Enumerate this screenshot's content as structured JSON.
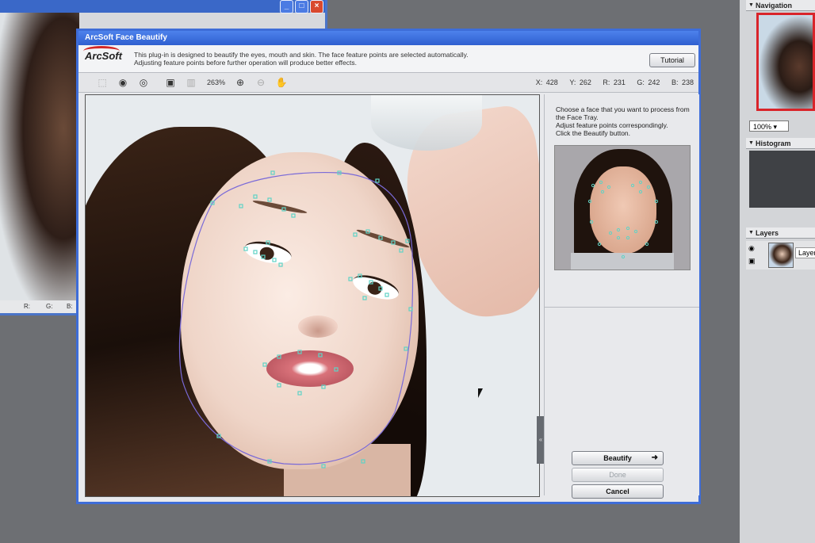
{
  "background_window": {
    "controls": [
      "_",
      "□",
      "×"
    ],
    "status": {
      "r": "R:",
      "g": "G:",
      "b": "B:"
    }
  },
  "right_panels": {
    "navigation": "Navigation",
    "zoom": "100%",
    "histogram": "Histogram",
    "layers": "Layers",
    "layer_name": "Layer-"
  },
  "dialog": {
    "title": "ArcSoft Face Beautify",
    "logo": "ArcSoft",
    "description_line1": "This plug-in is designed to beautify the eyes, mouth and skin. The face feature points are selected automatically.",
    "description_line2": "Adjusting feature points before further operation will produce better effects.",
    "tutorial_label": "Tutorial",
    "toolbar": {
      "zoom_percent": "263%"
    },
    "readout": {
      "x": "X: 428",
      "y": "Y: 262",
      "r": "R: 231",
      "g": "G: 242",
      "b": "B: 238"
    },
    "instructions": [
      "Choose a face that you want to process from",
      "the Face Tray.",
      "Adjust feature points correspondingly.",
      "Click the Beautify button."
    ],
    "buttons": {
      "beautify": "Beautify",
      "done": "Done",
      "cancel": "Cancel"
    }
  },
  "colors": {
    "titlebar": "#3e6dd8",
    "feature_point": "#5fd3c6",
    "face_outline": "#7a6ad8"
  },
  "icons": {
    "tool1": "face-select-icon",
    "tool2": "eye-icon",
    "tool3": "mouth-icon",
    "tool4": "fit-screen-icon",
    "tool5": "actual-size-icon",
    "zoom_in": "zoom-in-icon",
    "zoom_out": "zoom-out-icon",
    "hand": "hand-tool-icon"
  }
}
